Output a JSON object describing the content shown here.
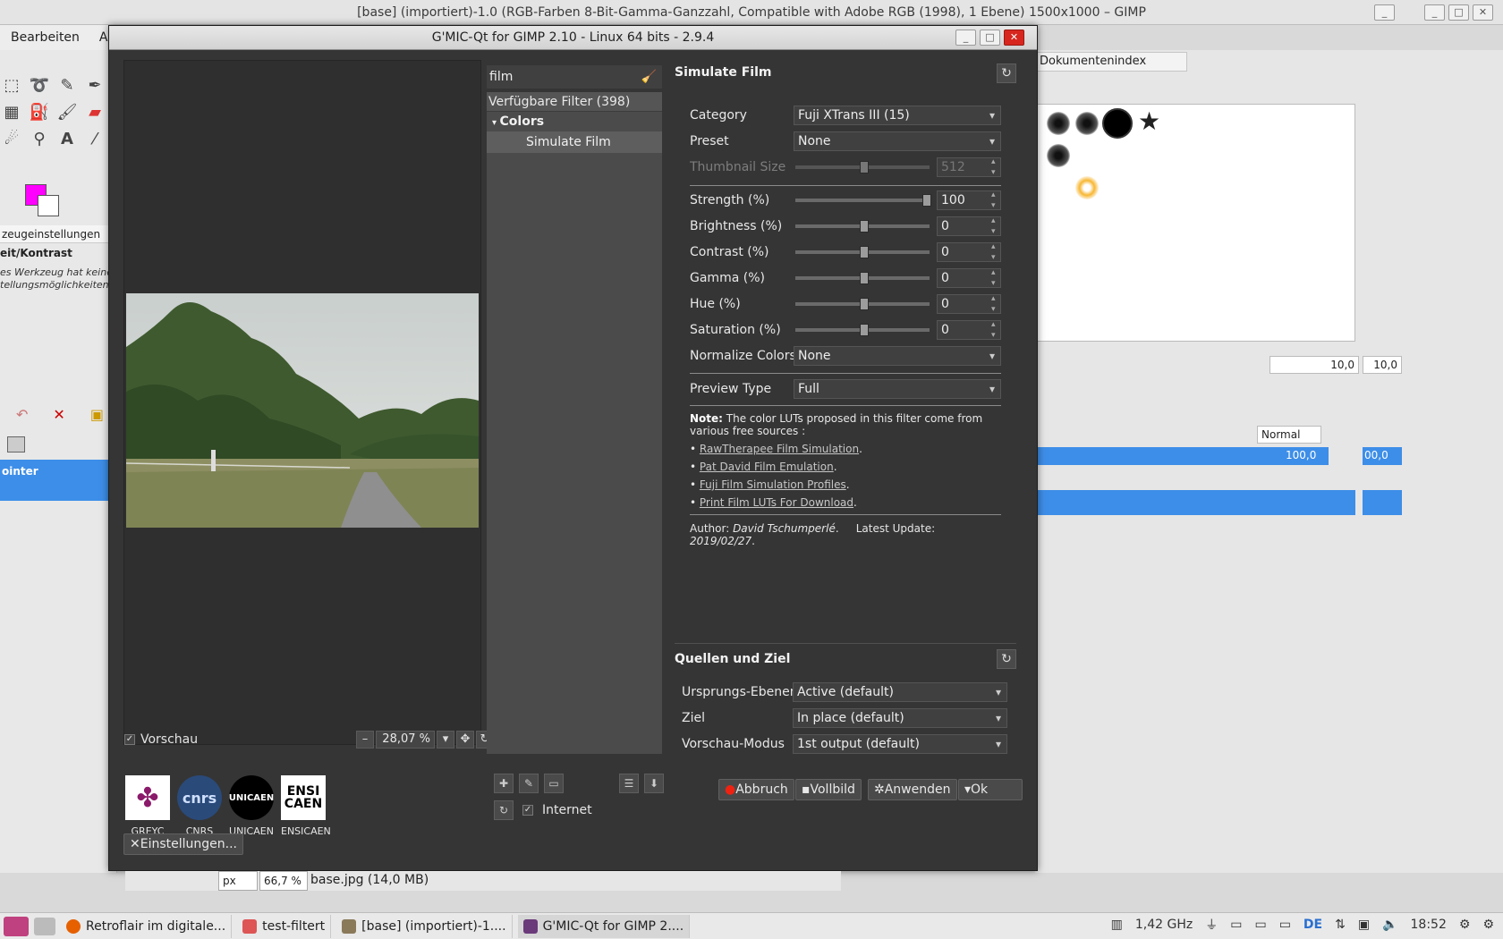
{
  "gimp": {
    "title": "[base] (importiert)-1.0 (RGB-Farben 8-Bit-Gamma-Ganzzahl, Compatible with Adobe RGB (1998), 1 Ebene) 1500x1000 – GIMP",
    "menu": [
      "Bearbeiten",
      "Ausw"
    ],
    "tool_options_tab": "zeugeinstellungen",
    "tool_name": "eit/Kontrast",
    "tool_hint": "es Werkzeug hat keine tellungsmöglichkeiten.",
    "layer_label": "ointer",
    "dock_tab": "Dokumentenindex",
    "dock_value_1": "10,0",
    "dock_value_2": "10,0",
    "mode": "Normal",
    "opacity": "100,0",
    "opacity_2": "00,0",
    "fg_color": "#ff00ff",
    "status": {
      "unit": "px",
      "zoom": "66,7 %",
      "file": "base.jpg (14,0 MB)"
    }
  },
  "gmic": {
    "title": "G'MIC-Qt for GIMP 2.10 - Linux 64 bits - 2.9.4",
    "preview_label": "Vorschau",
    "zoom": "28,07 %",
    "logos": [
      "GREYC",
      "CNRS",
      "UNICAEN",
      "ENSICAEN"
    ],
    "settings_button": "Einstellungen...",
    "search_value": "film",
    "filter_header": "Verfügbare Filter (398)",
    "category": "Colors",
    "selected_filter": "Simulate Film",
    "internet_label": "Internet",
    "filter_title": "Simulate Film",
    "params": {
      "category": {
        "label": "Category",
        "value": "Fuji XTrans III (15)"
      },
      "preset": {
        "label": "Preset",
        "value": "None"
      },
      "thumbnail": {
        "label": "Thumbnail Size",
        "value": "512"
      },
      "strength": {
        "label": "Strength (%)",
        "value": "100"
      },
      "brightness": {
        "label": "Brightness (%)",
        "value": "0"
      },
      "contrast": {
        "label": "Contrast (%)",
        "value": "0"
      },
      "gamma": {
        "label": "Gamma (%)",
        "value": "0"
      },
      "hue": {
        "label": "Hue (%)",
        "value": "0"
      },
      "saturation": {
        "label": "Saturation (%)",
        "value": "0"
      },
      "normalize": {
        "label": "Normalize Colors",
        "value": "None"
      },
      "preview_type": {
        "label": "Preview Type",
        "value": "Full"
      }
    },
    "note": {
      "prefix": "Note:",
      "text": " The color LUTs proposed in this filter come from various free sources :",
      "links": [
        "RawTherapee Film Simulation",
        "Pat David Film Emulation",
        "Fuji Film Simulation Profiles",
        "Print Film LUTs For Download"
      ],
      "author_label": "Author:",
      "author": "David Tschumperlé",
      "update_label": "Latest Update:",
      "update": "2019/02/27"
    },
    "io_title": "Quellen und Ziel",
    "io": {
      "source": {
        "label": "Ursprungs-Ebenen",
        "value": "Active (default)"
      },
      "target": {
        "label": "Ziel",
        "value": "In place (default)"
      },
      "preview_mode": {
        "label": "Vorschau-Modus",
        "value": "1st output (default)"
      }
    },
    "buttons": {
      "cancel": "Abbruch",
      "fullscreen": "Vollbild",
      "apply": "Anwenden",
      "ok": "Ok"
    }
  },
  "taskbar": {
    "tasks": [
      "Retroflair im digitale...",
      "test-filtert",
      "[base] (importiert)-1....",
      "G'MIC-Qt for GIMP 2...."
    ],
    "cpu": "1,42 GHz",
    "lang": "DE",
    "time": "18:52"
  }
}
